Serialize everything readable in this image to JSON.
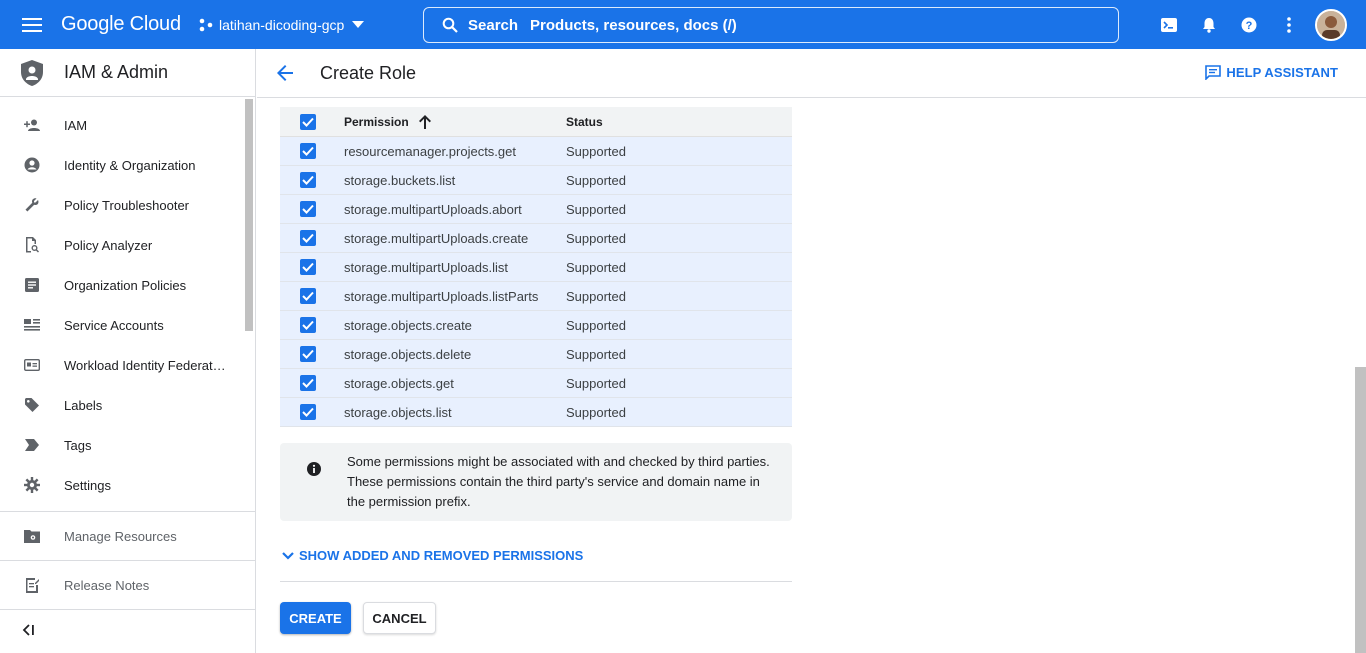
{
  "topbar": {
    "brand": "Google Cloud",
    "project": "latihan-dicoding-gcp",
    "search_label": "Search",
    "search_placeholder": "Products, resources, docs (/)"
  },
  "sidebar": {
    "title": "IAM & Admin",
    "items": [
      {
        "label": "IAM",
        "icon": "person-add-icon"
      },
      {
        "label": "Identity & Organization",
        "icon": "account-circle-icon"
      },
      {
        "label": "Policy Troubleshooter",
        "icon": "wrench-icon"
      },
      {
        "label": "Policy Analyzer",
        "icon": "document-search-icon"
      },
      {
        "label": "Organization Policies",
        "icon": "list-doc-icon"
      },
      {
        "label": "Service Accounts",
        "icon": "service-account-icon"
      },
      {
        "label": "Workload Identity Federat…",
        "icon": "id-card-icon"
      },
      {
        "label": "Labels",
        "icon": "label-icon"
      },
      {
        "label": "Tags",
        "icon": "tag-icon"
      },
      {
        "label": "Settings",
        "icon": "gear-icon"
      }
    ],
    "manage_resources": "Manage Resources",
    "release_notes": "Release Notes"
  },
  "header": {
    "title": "Create Role",
    "help": "HELP ASSISTANT"
  },
  "table": {
    "col_permission": "Permission",
    "col_status": "Status",
    "rows": [
      {
        "permission": "resourcemanager.projects.get",
        "status": "Supported"
      },
      {
        "permission": "storage.buckets.list",
        "status": "Supported"
      },
      {
        "permission": "storage.multipartUploads.abort",
        "status": "Supported"
      },
      {
        "permission": "storage.multipartUploads.create",
        "status": "Supported"
      },
      {
        "permission": "storage.multipartUploads.list",
        "status": "Supported"
      },
      {
        "permission": "storage.multipartUploads.listParts",
        "status": "Supported"
      },
      {
        "permission": "storage.objects.create",
        "status": "Supported"
      },
      {
        "permission": "storage.objects.delete",
        "status": "Supported"
      },
      {
        "permission": "storage.objects.get",
        "status": "Supported"
      },
      {
        "permission": "storage.objects.list",
        "status": "Supported"
      }
    ]
  },
  "info": {
    "text": "Some permissions might be associated with and checked by third parties. These permissions contain the third party's service and domain name in the permission prefix."
  },
  "show_added": "SHOW ADDED AND REMOVED PERMISSIONS",
  "buttons": {
    "create": "CREATE",
    "cancel": "CANCEL"
  },
  "colors": {
    "brand_blue": "#1a73e8",
    "row_selected": "#e8f0fe"
  }
}
